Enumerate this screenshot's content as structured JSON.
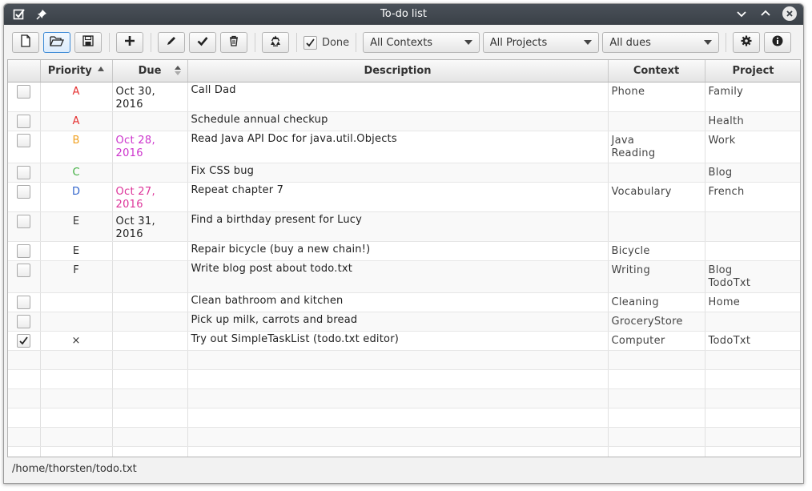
{
  "window": {
    "title": "To-do list"
  },
  "toolbar": {
    "done_label": "Done",
    "done_checked": true,
    "filters": {
      "contexts": "All Contexts",
      "projects": "All Projects",
      "dues": "All dues"
    }
  },
  "columns": {
    "priority": "Priority",
    "due": "Due",
    "description": "Description",
    "context": "Context",
    "project": "Project"
  },
  "colors": {
    "prio_A": "#e53030",
    "prio_B": "#f0a020",
    "prio_C": "#3fae3f",
    "prio_D": "#3366cc",
    "due_highlight": "#cc33cc",
    "accent": "#3d8ad6"
  },
  "tasks": [
    {
      "done": false,
      "priority": "A",
      "due": "Oct 30, 2016",
      "description": "Call Dad",
      "context": "Phone",
      "project": "Family"
    },
    {
      "done": false,
      "priority": "A",
      "due": "",
      "description": "Schedule annual checkup",
      "context": "",
      "project": "Health"
    },
    {
      "done": false,
      "priority": "B",
      "due": "Oct 28, 2016",
      "description": "Read Java API Doc for java.util.Objects",
      "context": "Java\nReading",
      "project": "Work"
    },
    {
      "done": false,
      "priority": "C",
      "due": "",
      "description": "Fix CSS bug",
      "context": "",
      "project": "Blog"
    },
    {
      "done": false,
      "priority": "D",
      "due": "Oct 27, 2016",
      "description": "Repeat chapter 7",
      "context": "Vocabulary",
      "project": "French"
    },
    {
      "done": false,
      "priority": "E",
      "due": "Oct 31, 2016",
      "description": "Find a birthday present for Lucy",
      "context": "",
      "project": ""
    },
    {
      "done": false,
      "priority": "E",
      "due": "",
      "description": "Repair bicycle (buy a new chain!)",
      "context": "Bicycle",
      "project": ""
    },
    {
      "done": false,
      "priority": "F",
      "due": "",
      "description": "Write blog post about todo.txt",
      "context": "Writing",
      "project": "Blog\nTodoTxt"
    },
    {
      "done": false,
      "priority": "",
      "due": "",
      "description": "Clean bathroom and kitchen",
      "context": "Cleaning",
      "project": "Home"
    },
    {
      "done": false,
      "priority": "",
      "due": "",
      "description": "Pick up milk, carrots and bread",
      "context": "GroceryStore",
      "project": ""
    },
    {
      "done": true,
      "priority": "×",
      "due": "",
      "description": "Try out SimpleTaskList (todo.txt editor)",
      "context": "Computer",
      "project": "TodoTxt"
    }
  ],
  "status": {
    "file_path": "/home/thorsten/todo.txt"
  }
}
